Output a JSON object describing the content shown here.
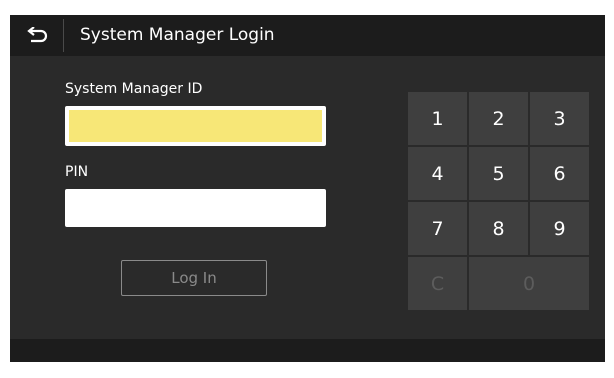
{
  "header": {
    "title": "System Manager Login",
    "back_icon": "return-arrow-icon"
  },
  "form": {
    "id_label": "System Manager ID",
    "id_value": "",
    "pin_label": "PIN",
    "pin_value": "",
    "login_label": "Log In"
  },
  "keypad": {
    "keys": [
      "1",
      "2",
      "3",
      "4",
      "5",
      "6",
      "7",
      "8",
      "9",
      "C",
      "0"
    ]
  },
  "colors": {
    "active_field": "#f7e777",
    "background": "#2a2a2a",
    "bar": "#1c1c1c",
    "key": "#3f3f3f"
  }
}
